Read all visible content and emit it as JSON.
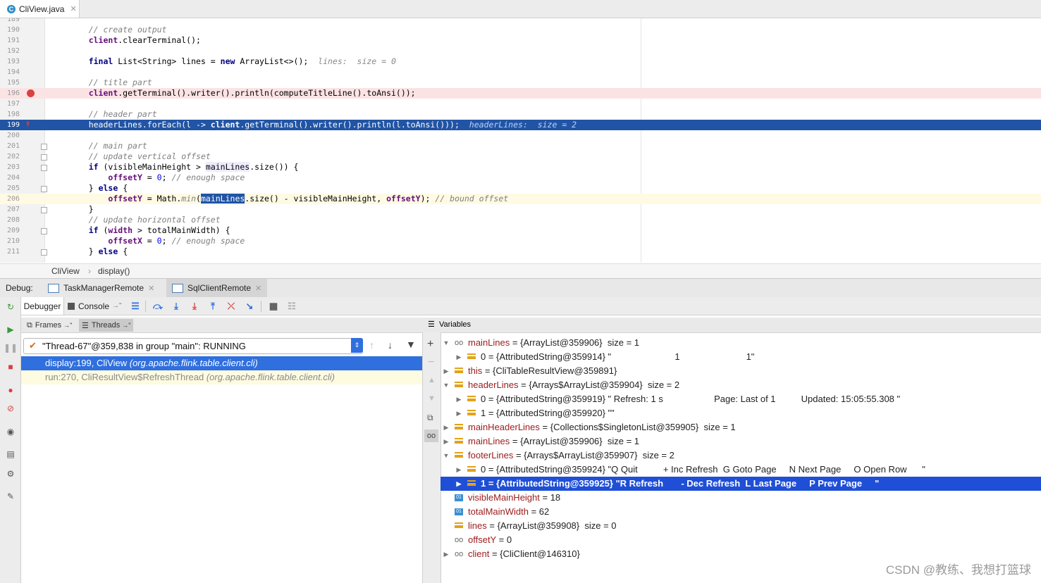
{
  "editor_tab": {
    "title": "CliView.java",
    "icon_letter": "C"
  },
  "code_lines": [
    {
      "n": "189",
      "t": "[]"
    },
    {
      "n": "190",
      "t": "[[\"cm\",\"// create output\"]]"
    },
    {
      "n": "191",
      "t": "[[\"fld\",\"client\"],[\"\",\".clearTerminal();\"]]"
    },
    {
      "n": "192",
      "t": "[]"
    },
    {
      "n": "193",
      "t": "[[\"kw\",\"final \"],[\"\",\"List<String> lines = \"],[\"kw\",\"new \"],[\"\",\"ArrayList<>();  \"],[\"inl\",\"lines:  size = 0\"]]"
    },
    {
      "n": "194",
      "t": "[]"
    },
    {
      "n": "195",
      "t": "[[\"cm\",\"// title part\"]]"
    },
    {
      "n": "196",
      "t": "[[\"fld\",\"client\"],[\"\",\".getTerminal().writer().println(computeTitleLine().toAnsi());\"]]"
    },
    {
      "n": "197",
      "t": "[]"
    },
    {
      "n": "198",
      "t": "[[\"cm\",\"// header part\"]]"
    },
    {
      "n": "199",
      "t": "[[\"\",\"headerLines.forEach(l -> \"],[\"fld\",\"client\"],[\"\",\".getTerminal().writer().println(l.toAnsi()));  \"],[\"inl\",\"headerLines:  size = 2\"]]"
    },
    {
      "n": "200",
      "t": "[]"
    },
    {
      "n": "201",
      "t": "[[\"cm\",\"// main part\"]]"
    },
    {
      "n": "202",
      "t": "[[\"cm\",\"// update vertical offset\"]]"
    },
    {
      "n": "203",
      "t": "[[\"kw\",\"if \"],[\"\",\"(visibleMainHeight > \"],[\"hl\",\"mainLines\"],[\"\",\".size()) {\"]]"
    },
    {
      "n": "204",
      "t": "[[\"\",\"    \"],[\"fld\",\"offsetY\"],[\"\",\" = \"],[\"num\",\"0\"],[\"\",\"; \"],[\"cm\",\"// enough space\"]]"
    },
    {
      "n": "205",
      "t": "[[\"\",\"} \"],[\"kw\",\"else \"],[\"\",\"{\"]]"
    },
    {
      "n": "206",
      "t": "[[\"\",\"    \"],[\"fld\",\"offsetY\"],[\"\",\" = Math.\"],[\"cm\",\"min\"],[\"\",\"(\"],[\"sel\",\"mainLines\"],[\"\",\".size() - visibleMainHeight, \"],[\"fld\",\"offsetY\"],[\"\",\"); \"],[\"cm\",\"// bound offset\"]]"
    },
    {
      "n": "207",
      "t": "[[\"\",\"}\"]]"
    },
    {
      "n": "208",
      "t": "[[\"cm\",\"// update horizontal offset\"]]"
    },
    {
      "n": "209",
      "t": "[[\"kw\",\"if \"],[\"\",\"(\"],[\"fld\",\"width\"],[\"\",\" > totalMainWidth) {\"]]"
    },
    {
      "n": "210",
      "t": "[[\"\",\"    \"],[\"fld\",\"offsetX\"],[\"\",\" = \"],[\"num\",\"0\"],[\"\",\"; \"],[\"cm\",\"// enough space\"]]"
    },
    {
      "n": "211",
      "t": "[[\"\",\"} \"],[\"kw\",\"else \"],[\"\",\"{\"]]"
    }
  ],
  "breadcrumb": {
    "class": "CliView",
    "method": "display()"
  },
  "debug": {
    "label": "Debug:",
    "tabs": [
      {
        "label": "TaskManagerRemote"
      },
      {
        "label": "SqlClientRemote"
      }
    ]
  },
  "toolbar": {
    "debugger_tab": "Debugger",
    "console_tab": "Console"
  },
  "frames": {
    "tab_frames": "Frames",
    "tab_threads": "Threads",
    "thread": "\"Thread-67\"@359,838 in group \"main\": RUNNING",
    "rows": [
      {
        "main": "display:199, CliView",
        "pkg": "(org.apache.flink.table.client.cli)"
      },
      {
        "main": "run:270, CliResultView$RefreshThread",
        "pkg": "(org.apache.flink.table.client.cli)"
      }
    ]
  },
  "variables": {
    "title": "Variables",
    "rows": [
      {
        "indent": 0,
        "expand": "down",
        "icon": "glasses",
        "name": "mainLines",
        "text": " = {ArrayList@359906}  size = 1"
      },
      {
        "indent": 1,
        "expand": "right",
        "icon": "list",
        "name": "",
        "text": "0 = {AttributedString@359914} \"                         1                          1\""
      },
      {
        "indent": 0,
        "expand": "right",
        "icon": "list",
        "name": "this",
        "text": " = {CliTableResultView@359891}"
      },
      {
        "indent": 0,
        "expand": "down",
        "icon": "list",
        "name": "headerLines",
        "text": " = {Arrays$ArrayList@359904}  size = 2"
      },
      {
        "indent": 1,
        "expand": "right",
        "icon": "list",
        "name": "",
        "text": "0 = {AttributedString@359919} \" Refresh: 1 s                    Page: Last of 1          Updated: 15:05:55.308 \""
      },
      {
        "indent": 1,
        "expand": "right",
        "icon": "list",
        "name": "",
        "text": "1 = {AttributedString@359920} \"\""
      },
      {
        "indent": 0,
        "expand": "right",
        "icon": "list",
        "name": "mainHeaderLines",
        "text": " = {Collections$SingletonList@359905}  size = 1"
      },
      {
        "indent": 0,
        "expand": "right",
        "icon": "list",
        "name": "mainLines",
        "text": " = {ArrayList@359906}  size = 1"
      },
      {
        "indent": 0,
        "expand": "down",
        "icon": "list",
        "name": "footerLines",
        "text": " = {Arrays$ArrayList@359907}  size = 2"
      },
      {
        "indent": 1,
        "expand": "right",
        "icon": "list",
        "name": "",
        "text": "0 = {AttributedString@359924} \"Q Quit          + Inc Refresh  G Goto Page     N Next Page     O Open Row      \""
      },
      {
        "indent": 1,
        "expand": "right",
        "icon": "list",
        "name": "",
        "text": "1 = {AttributedString@359925} \"R Refresh       - Dec Refresh  L Last Page     P Prev Page     \"",
        "selected": true
      },
      {
        "indent": 0,
        "expand": "",
        "icon": "prim",
        "name": "visibleMainHeight",
        "text": " = 18"
      },
      {
        "indent": 0,
        "expand": "",
        "icon": "prim",
        "name": "totalMainWidth",
        "text": " = 62"
      },
      {
        "indent": 0,
        "expand": "",
        "icon": "list",
        "name": "lines",
        "text": " = {ArrayList@359908}  size = 0"
      },
      {
        "indent": 0,
        "expand": "",
        "icon": "glasses",
        "name": "offsetY",
        "text": " = 0"
      },
      {
        "indent": 0,
        "expand": "right",
        "icon": "glasses",
        "name": "client",
        "text": " = {CliClient@146310}"
      }
    ]
  },
  "watermark": "CSDN @教练、我想打篮球",
  "colors": {
    "exec_line": "#2154a4",
    "selection": "#2f6fde",
    "breakpoint": "#d94040"
  }
}
